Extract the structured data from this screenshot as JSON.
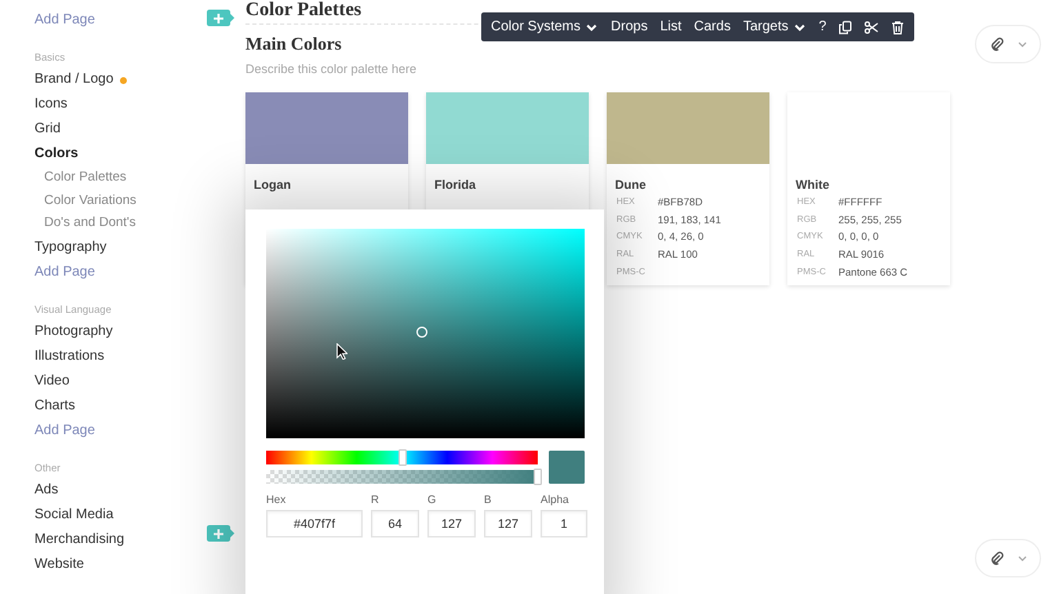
{
  "sidebar": {
    "sections": [
      {
        "items": [
          {
            "label": "Add Page",
            "kind": "add"
          }
        ]
      },
      {
        "title": "Basics",
        "items": [
          {
            "label": "Brand / Logo",
            "kind": "page",
            "selected": false,
            "flagged": true
          },
          {
            "label": "Icons",
            "kind": "page",
            "selected": false,
            "flagged": false
          },
          {
            "label": "Grid",
            "kind": "page",
            "selected": false,
            "flagged": false
          },
          {
            "label": "Colors",
            "kind": "page",
            "selected": true,
            "flagged": false,
            "children": [
              {
                "label": "Color Palettes",
                "selected": false
              },
              {
                "label": "Color Variations",
                "selected": false
              },
              {
                "label": "Do's and Dont's",
                "selected": false
              }
            ]
          },
          {
            "label": "Typography",
            "kind": "page",
            "selected": false,
            "flagged": false
          },
          {
            "label": "Add Page",
            "kind": "add"
          }
        ]
      },
      {
        "title": "Visual Language",
        "items": [
          {
            "label": "Photography",
            "kind": "page",
            "selected": false,
            "flagged": false
          },
          {
            "label": "Illustrations",
            "kind": "page",
            "selected": false,
            "flagged": false
          },
          {
            "label": "Video",
            "kind": "page",
            "selected": false,
            "flagged": false
          },
          {
            "label": "Charts",
            "kind": "page",
            "selected": false,
            "flagged": false
          },
          {
            "label": "Add Page",
            "kind": "add"
          }
        ]
      },
      {
        "title": "Other",
        "items": [
          {
            "label": "Ads",
            "kind": "page",
            "selected": false,
            "flagged": false
          },
          {
            "label": "Social Media",
            "kind": "page",
            "selected": false,
            "flagged": false
          },
          {
            "label": "Merchandising",
            "kind": "page",
            "selected": false,
            "flagged": false
          },
          {
            "label": "Website",
            "kind": "page",
            "selected": false,
            "flagged": false
          }
        ]
      }
    ]
  },
  "page": {
    "title": "Color Palettes",
    "section_title": "Main Colors",
    "description_placeholder": "Describe this color palette here"
  },
  "toolbar": {
    "items": [
      {
        "label": "Color Systems",
        "kind": "dropdown"
      },
      {
        "label": "Drops",
        "kind": "plain"
      },
      {
        "label": "List",
        "kind": "plain"
      },
      {
        "label": "Cards",
        "kind": "plain"
      },
      {
        "label": "Targets",
        "kind": "dropdown"
      },
      {
        "label": "?",
        "kind": "plain"
      }
    ]
  },
  "colors": [
    {
      "name": "Logan",
      "color": "#898cb6"
    },
    {
      "name": "Florida",
      "color": "#91dad2"
    },
    {
      "name": "Dune",
      "color": "#bfb78d",
      "rows": [
        {
          "label": "HEX",
          "value": "#BFB78D"
        },
        {
          "label": "RGB",
          "value": "191, 183, 141"
        },
        {
          "label": "CMYK",
          "value": "0, 4, 26, 0"
        },
        {
          "label": "RAL",
          "value": "RAL 100"
        },
        {
          "label": "PMS-C"
        }
      ]
    },
    {
      "name": "White",
      "color": "#ffffff",
      "rows": [
        {
          "label": "HEX",
          "value": "#FFFFFF"
        },
        {
          "label": "RGB",
          "value": "255, 255, 255"
        },
        {
          "label": "CMYK",
          "value": "0, 0, 0, 0"
        },
        {
          "label": "RAL",
          "value": "RAL 9016"
        },
        {
          "label": "PMS-C",
          "value": "Pantone 663 C"
        }
      ]
    }
  ],
  "picker": {
    "hue": {
      "level": 0.5
    },
    "alpha": {
      "level": 1
    },
    "fields": [
      {
        "label": "Hex",
        "value": "#407f7f"
      },
      {
        "label": "R",
        "value": "64"
      },
      {
        "label": "G",
        "value": "127"
      },
      {
        "label": "B",
        "value": "127"
      },
      {
        "label": "Alpha",
        "value": "1"
      }
    ]
  }
}
